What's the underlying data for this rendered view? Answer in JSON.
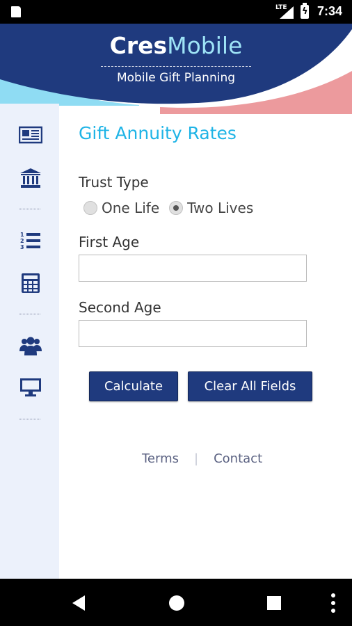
{
  "status_bar": {
    "network": "LTE",
    "time": "7:34",
    "icons": [
      "sd-card-icon",
      "signal-icon",
      "battery-charging-icon"
    ]
  },
  "header": {
    "brand_bold": "Cres",
    "brand_light": "Mobile",
    "tagline": "Mobile Gift Planning",
    "colors": {
      "navy": "#1f3a7e",
      "light_blue": "#8fdcf3",
      "pink": "#ec9a9d"
    }
  },
  "sidebar": {
    "items": [
      {
        "icon": "newspaper-icon"
      },
      {
        "icon": "bank-icon"
      },
      {
        "icon": "numbered-list-icon"
      },
      {
        "icon": "calculator-icon"
      },
      {
        "icon": "users-icon"
      },
      {
        "icon": "monitor-icon"
      }
    ]
  },
  "main": {
    "title": "Gift Annuity Rates",
    "trust_type_label": "Trust Type",
    "trust_options": [
      {
        "label": "One Life",
        "selected": false
      },
      {
        "label": "Two Lives",
        "selected": true
      }
    ],
    "first_age_label": "First Age",
    "first_age_value": "",
    "second_age_label": "Second Age",
    "second_age_value": "",
    "calculate_label": "Calculate",
    "clear_label": "Clear All Fields"
  },
  "footer": {
    "terms_label": "Terms",
    "separator": "|",
    "contact_label": "Contact"
  },
  "navbar": {
    "icons": [
      "back-icon",
      "home-icon",
      "recents-icon",
      "more-icon"
    ]
  }
}
